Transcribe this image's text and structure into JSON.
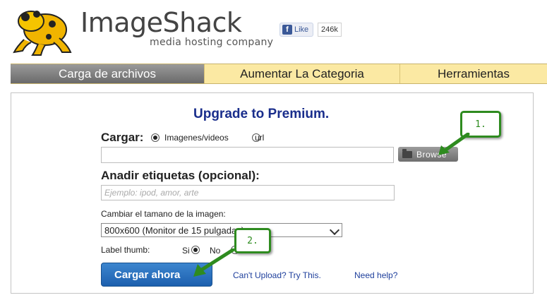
{
  "header": {
    "brand": "ImageShack",
    "tagline": "media hosting company",
    "fb_like_label": "Like",
    "fb_like_count": "246k"
  },
  "nav": {
    "tabs": [
      {
        "label": "Carga de archivos",
        "active": true
      },
      {
        "label": "Aumentar La Categoria",
        "active": false
      },
      {
        "label": "Herramientas",
        "active": false
      }
    ]
  },
  "form": {
    "title": "Upgrade to Premium.",
    "upload_label": "Cargar:",
    "upload_options": [
      {
        "label": "Imagenes/videos",
        "selected": true
      },
      {
        "label": "url",
        "selected": false
      }
    ],
    "file_value": "",
    "browse_label": "Browse",
    "tags_label": "Anadir etiquetas (opcional):",
    "tags_placeholder": "Ejemplo: ipod, amor, arte",
    "resize_label": "Cambiar el tamano de la imagen:",
    "resize_selected": "800x600 (Monitor de 15 pulgadas)",
    "thumb_label": "Label thumb:",
    "thumb_options": [
      {
        "label": "Si",
        "selected": true
      },
      {
        "label": "No",
        "selected": false
      }
    ],
    "submit_label": "Cargar ahora",
    "cant_upload_link": "Can't Upload? Try This.",
    "help_link": "Need help?"
  },
  "annotations": {
    "callout_1": "1.",
    "callout_2": "2.",
    "color": "#2e8b1f"
  },
  "colors": {
    "nav_active": "#7a7a7a",
    "nav_tab": "#fbe9a3",
    "title": "#1a2e8c",
    "button": "#2a6fbe"
  }
}
